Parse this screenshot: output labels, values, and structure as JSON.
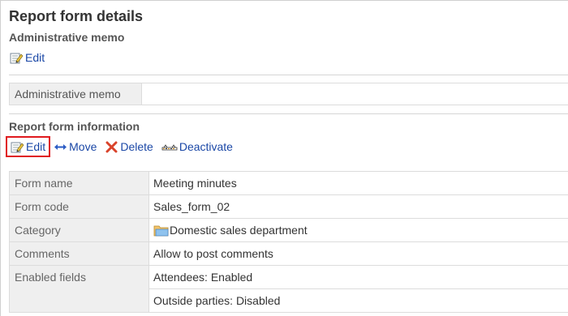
{
  "page": {
    "title": "Report form details"
  },
  "admin_memo": {
    "section_title": "Administrative memo",
    "edit_label": "Edit",
    "table_label": "Administrative memo",
    "table_value": ""
  },
  "report_info": {
    "section_title": "Report form information",
    "actions": {
      "edit": "Edit",
      "move": "Move",
      "delete": "Delete",
      "deactivate": "Deactivate"
    },
    "rows": {
      "form_name": {
        "label": "Form name",
        "value": "Meeting minutes"
      },
      "form_code": {
        "label": "Form code",
        "value": "Sales_form_02"
      },
      "category": {
        "label": "Category",
        "value": "Domestic sales department"
      },
      "comments": {
        "label": "Comments",
        "value": "Allow to post comments"
      },
      "enabled_fields": {
        "label": "Enabled fields",
        "values": [
          "Attendees: Enabled",
          "Outside parties: Disabled"
        ]
      }
    }
  },
  "colors": {
    "link": "#1a47a6",
    "highlight": "#e0191e",
    "label_bg": "#efefef"
  },
  "icons": {
    "edit": "edit-icon",
    "move": "move-arrows-icon",
    "delete": "delete-x-icon",
    "deactivate": "deactivate-icon",
    "folder": "folder-icon"
  }
}
